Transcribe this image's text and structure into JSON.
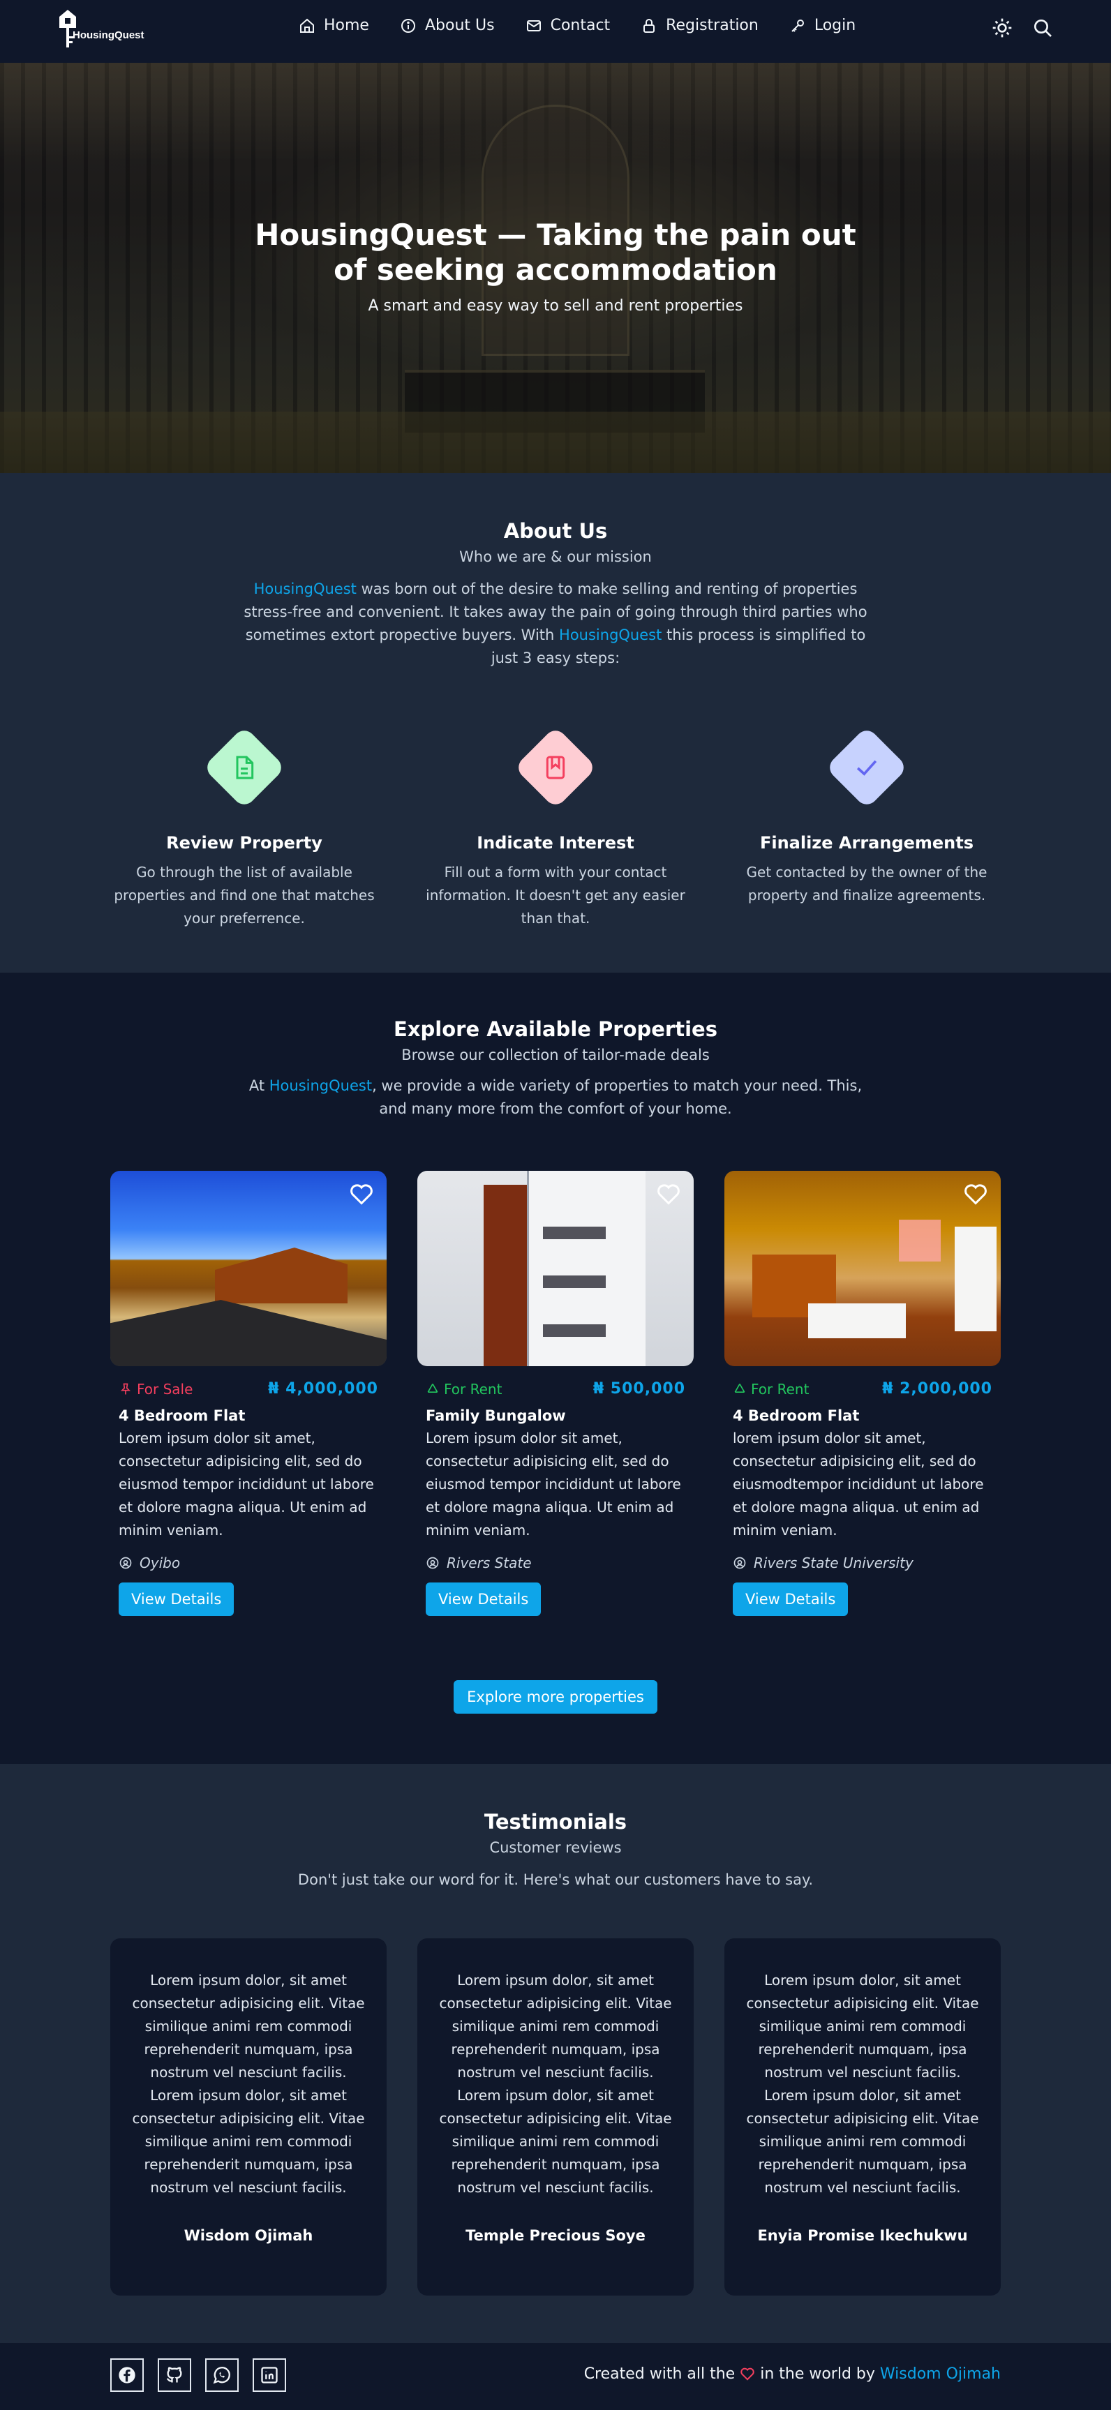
{
  "brand": {
    "name": "HousingQuest"
  },
  "nav": {
    "items": [
      {
        "label": "Home",
        "icon": "home-icon"
      },
      {
        "label": "About Us",
        "icon": "info-icon"
      },
      {
        "label": "Contact",
        "icon": "mail-icon"
      },
      {
        "label": "Registration",
        "icon": "lock-icon"
      },
      {
        "label": "Login",
        "icon": "key-icon"
      }
    ],
    "right_icons": [
      "sun-icon",
      "search-icon"
    ]
  },
  "hero": {
    "title_line1": "HousingQuest — Taking the pain out",
    "title_line2": "of seeking accommodation",
    "subtitle": "A smart and easy way to sell and rent properties"
  },
  "about": {
    "title": "About Us",
    "subtitle": "Who we are & our mission",
    "para_brand1": "HousingQuest",
    "para_part1": " was born out of the desire to make selling and renting of properties stress-free and convenient. It takes away the pain of going through third parties who sometimes extort propective buyers. With ",
    "para_brand2": "HousingQuest",
    "para_part2": " this process is simplified to just 3 easy steps:",
    "steps": [
      {
        "title": "Review Property",
        "text": "Go through the list of available properties and find one that matches your preferrence.",
        "icon": "document-icon",
        "color": "#86efac"
      },
      {
        "title": "Indicate Interest",
        "text": "Fill out a form with your contact information. It doesn't get any easier than that.",
        "icon": "bookmark-icon",
        "color": "#fda4af"
      },
      {
        "title": "Finalize Arrangements",
        "text": "Get contacted by the owner of the property and finalize agreements.",
        "icon": "check-icon",
        "color": "#a5b4fc"
      }
    ]
  },
  "properties": {
    "title": "Explore Available Properties",
    "subtitle": "Browse our collection of tailor-made deals",
    "para_prefix": "At ",
    "para_brand": "HousingQuest",
    "para_suffix": ", we provide a wide variety of properties to match your need. This, and many more from the comfort of your home.",
    "items": [
      {
        "tag": "For Sale",
        "tag_color": "#f43f5e",
        "tag_icon": "pin-icon",
        "price": "₦ 4,000,000",
        "title": "4 Bedroom Flat",
        "desc": "Lorem ipsum dolor sit amet, consectetur adipisicing elit, sed do eiusmod tempor incididunt ut labore et dolore magna aliqua. Ut enim ad minim veniam.",
        "location": "Oyibo",
        "button": "View Details"
      },
      {
        "tag": "For Rent",
        "tag_color": "#22c55e",
        "tag_icon": "recycle-icon",
        "price": "₦ 500,000",
        "title": "Family Bungalow",
        "desc": "Lorem ipsum dolor sit amet, consectetur adipisicing elit, sed do eiusmod tempor incididunt ut labore et dolore magna aliqua. Ut enim ad minim veniam.",
        "location": "Rivers State",
        "button": "View Details"
      },
      {
        "tag": "For Rent",
        "tag_color": "#22c55e",
        "tag_icon": "recycle-icon",
        "price": "₦ 2,000,000",
        "title": "4 Bedroom Flat",
        "desc": "lorem ipsum dolor sit amet, consectetur adipisicing elit, sed do eiusmodtempor incididunt ut labore et dolore magna aliqua. ut enim ad minim veniam.",
        "location": "Rivers State University",
        "button": "View Details"
      }
    ],
    "more_button": "Explore more properties"
  },
  "testimonials": {
    "title": "Testimonials",
    "subtitle": "Customer reviews",
    "intro": "Don't just take our word for it. Here's what our customers have to say.",
    "items": [
      {
        "p1": "Lorem ipsum dolor, sit amet consectetur adipisicing elit. Vitae similique animi rem commodi reprehenderit numquam, ipsa nostrum vel nesciunt facilis.",
        "p2": "Lorem ipsum dolor, sit amet consectetur adipisicing elit. Vitae similique animi rem commodi reprehenderit numquam, ipsa nostrum vel nesciunt facilis.",
        "name": "Wisdom Ojimah"
      },
      {
        "p1": "Lorem ipsum dolor, sit amet consectetur adipisicing elit. Vitae similique animi rem commodi reprehenderit numquam, ipsa nostrum vel nesciunt facilis.",
        "p2": "Lorem ipsum dolor, sit amet consectetur adipisicing elit. Vitae similique animi rem commodi reprehenderit numquam, ipsa nostrum vel nesciunt facilis.",
        "name": "Temple Precious Soye"
      },
      {
        "p1": "Lorem ipsum dolor, sit amet consectetur adipisicing elit. Vitae similique animi rem commodi reprehenderit numquam, ipsa nostrum vel nesciunt facilis.",
        "p2": "Lorem ipsum dolor, sit amet consectetur adipisicing elit. Vitae similique animi rem commodi reprehenderit numquam, ipsa nostrum vel nesciunt facilis.",
        "name": "Enyia Promise Ikechukwu"
      }
    ]
  },
  "footer": {
    "socials": [
      "facebook-icon",
      "github-icon",
      "whatsapp-icon",
      "linkedin-icon"
    ],
    "credit_prefix": "Created with all the ",
    "credit_middle": " in the world by ",
    "credit_author": "Wisdom Ojimah"
  },
  "colors": {
    "accent": "#0ea5e9",
    "bg_dark": "#0f172a",
    "bg_section": "#1e293b"
  }
}
